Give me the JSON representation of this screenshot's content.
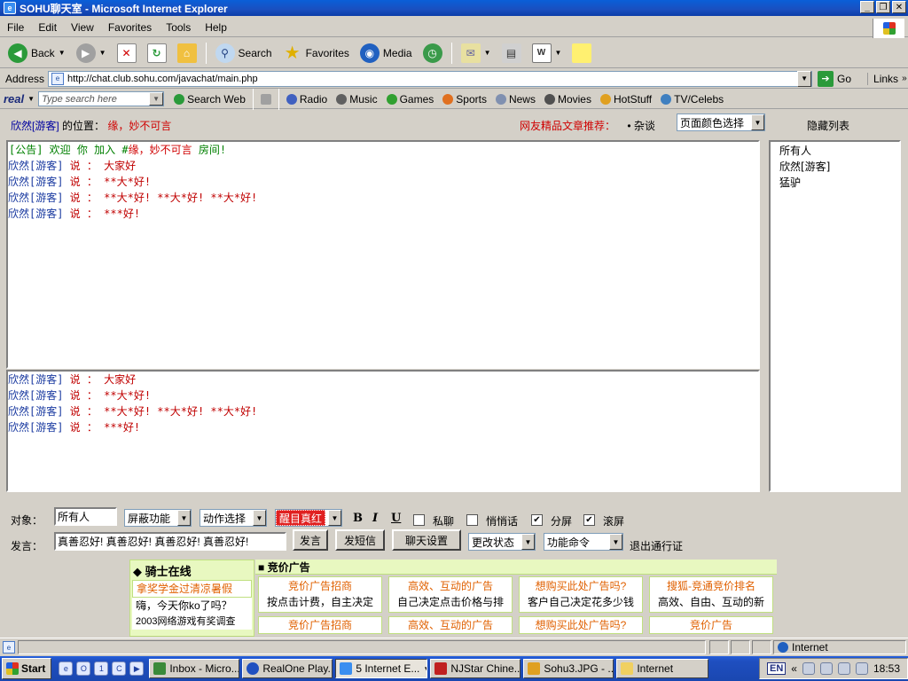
{
  "window": {
    "title": "SOHU聊天室 - Microsoft Internet Explorer"
  },
  "menu": [
    "File",
    "Edit",
    "View",
    "Favorites",
    "Tools",
    "Help"
  ],
  "toolbar": {
    "back": "Back",
    "search": "Search",
    "favorites": "Favorites",
    "media": "Media"
  },
  "address": {
    "label": "Address",
    "url": "http://chat.club.sohu.com/javachat/main.php",
    "go": "Go",
    "links": "Links"
  },
  "realbar": {
    "brand": "real",
    "search_placeholder": "Type search here",
    "search_web": "Search Web",
    "items": [
      "Radio",
      "Music",
      "Games",
      "Sports",
      "News",
      "Movies",
      "HotStuff",
      "TV/Celebs"
    ]
  },
  "chat": {
    "location": {
      "user": "欣然[游客]",
      "label": "的位置：",
      "room": "缘，妙不可言"
    },
    "recommend_label": "网友精品文章推荐：",
    "recommend_item": "• 杂谈",
    "color_select": "页面颜色选择",
    "hide_list": "隐藏列表",
    "announce": {
      "prefix": "[公告] 欢迎 你 加入 #",
      "room": "缘，妙不可言",
      "suffix": " 房间!"
    },
    "main_messages": [
      {
        "name": "欣然[游客]",
        "says": " 说 ： ",
        "text": "大家好"
      },
      {
        "name": "欣然[游客]",
        "says": " 说 ： ",
        "text": "**大*好!"
      },
      {
        "name": "欣然[游客]",
        "says": " 说 ： ",
        "text": "**大*好! **大*好! **大*好!"
      },
      {
        "name": "欣然[游客]",
        "says": " 说 ： ",
        "text": "***好!"
      }
    ],
    "sub_messages": [
      {
        "name": "欣然[游客]",
        "says": " 说 ： ",
        "text": "大家好"
      },
      {
        "name": "欣然[游客]",
        "says": " 说 ： ",
        "text": "**大*好!"
      },
      {
        "name": "欣然[游客]",
        "says": " 说 ： ",
        "text": "**大*好! **大*好! **大*好!"
      },
      {
        "name": "欣然[游客]",
        "says": " 说 ： ",
        "text": "***好!"
      }
    ],
    "users": [
      "所有人",
      "欣然[游客]",
      "猛驴"
    ]
  },
  "controls": {
    "target_label": "对象：",
    "target_value": "所有人",
    "block": "屏蔽功能",
    "action": "动作选择",
    "color": "醒目真红",
    "bold": "B",
    "italic": "I",
    "underline": "U",
    "private": "私聊",
    "whisper": "悄悄话",
    "split": "分屏",
    "scroll": "滚屏",
    "split_checked": "✔",
    "scroll_checked": "✔",
    "speak_label": "发言：",
    "speak_value": "真善忍好! 真善忍好! 真善忍好! 真善忍好!",
    "send": "发言",
    "sms": "发短信",
    "settings": "聊天设置",
    "status": "更改状态",
    "command": "功能命令",
    "logout": "退出通行证"
  },
  "ads": {
    "knight_title": "◆ 骑士在线",
    "knight_items": [
      "拿奖学金过清凉暑假",
      "嗨，今天你ko了吗？",
      "2003网络游戏有奖调查"
    ],
    "bid_title": "■ 竞价广告",
    "boxes": [
      {
        "title": "竞价广告招商",
        "desc": "按点击计费，自主决定"
      },
      {
        "title": "高效、互动的广告",
        "desc": "自己决定点击价格与排"
      },
      {
        "title": "想购买此处广告吗?",
        "desc": "客户自己决定花多少钱"
      },
      {
        "title": "搜狐-竞通竞价排名",
        "desc": "高效、自由、互动的新"
      }
    ],
    "boxes2": [
      "竞价广告招商",
      "高效、互动的广告",
      "想购买此处广告吗?",
      "竞价广告"
    ]
  },
  "status": {
    "zone": "Internet"
  },
  "taskbar": {
    "start": "Start",
    "tasks": [
      "Inbox - Micro...",
      "RealOne Play...",
      "5 Internet E...",
      "NJStar Chine...",
      "Sohu3.JPG - ...",
      "Internet"
    ],
    "lang": "EN",
    "clock": "18:53"
  }
}
